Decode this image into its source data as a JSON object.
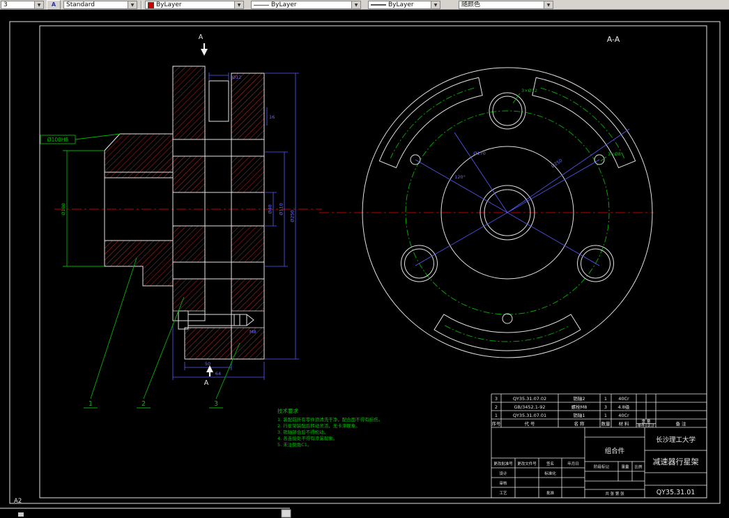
{
  "toolbar": {
    "layer_value": "3",
    "style_value": "Standard",
    "color_value": "ByLayer",
    "linetype_value": "ByLayer",
    "lineweight_value": "ByLayer",
    "plotstyle_value": "随颜色"
  },
  "icons": {
    "dropdown_arrow": "▼",
    "style_glyph": "A"
  },
  "drawing": {
    "sheet_label": "A2",
    "section_mark_top": "A",
    "section_mark_bottom": "A",
    "section_view_label": "A-A",
    "balloons": {
      "b1": "1",
      "b2": "2",
      "b3": "3"
    },
    "dims": {
      "pin_dia": "Ø12",
      "fit_callout": "Ø100H8",
      "hub_dia": "Ø100",
      "step": "16",
      "bore": "Ø40",
      "flange_dia": "Ø110",
      "disc_dia": "Ø250",
      "width_a": "50",
      "width_b": "64",
      "bolt": "M8",
      "holes_big": "3×Ø12",
      "holes_small": "3×Ø8",
      "od": "Ø250",
      "pcd": "Ø170",
      "angle": "120°"
    },
    "notes": {
      "title": "技术要求",
      "l1": "1. 装配前所有零件须清洗干净，配合面不得有损伤。",
      "l2": "2. 行星架装配后转动灵活，无卡滞现象。",
      "l3": "3. 销轴铆合后不得松动。",
      "l4": "4. 各连接处不得有渗漏现象。",
      "l5": "5. 未注倒角C1。"
    }
  },
  "title_block": {
    "headers": {
      "seq": "序号",
      "code": "代 号",
      "name": "名 称",
      "qty": "数量",
      "material": "材 料",
      "unit": "单件",
      "total": "总计",
      "weight": "重 量",
      "remark": "备 注"
    },
    "parts": [
      {
        "seq": "3",
        "code": "QY35.31.07.02",
        "name": "销轴2",
        "qty": "1",
        "material": "40Cr"
      },
      {
        "seq": "2",
        "code": "GB/3452.1-92",
        "name": "螺栓M8",
        "qty": "3",
        "material": "4.8级"
      },
      {
        "seq": "1",
        "code": "QY35.31.07.01",
        "name": "销轴1",
        "qty": "1",
        "material": "40Cr"
      }
    ],
    "rev": {
      "c1": "更改批准号",
      "c2": "更改文件号",
      "c3": "签名",
      "c4": "年月日"
    },
    "roles": {
      "design": "设计",
      "standardize": "标准化",
      "check": "审核",
      "craft": "工艺",
      "approve": "批准"
    },
    "assembly": "组合件",
    "stage_label": "阶段标记",
    "weight_label": "重量",
    "scale_label": "比例",
    "sheet_count": "共 张 第 张",
    "university": "长沙理工大学",
    "part_title": "减速器行星架",
    "drawing_no": "QY35.31.01"
  }
}
